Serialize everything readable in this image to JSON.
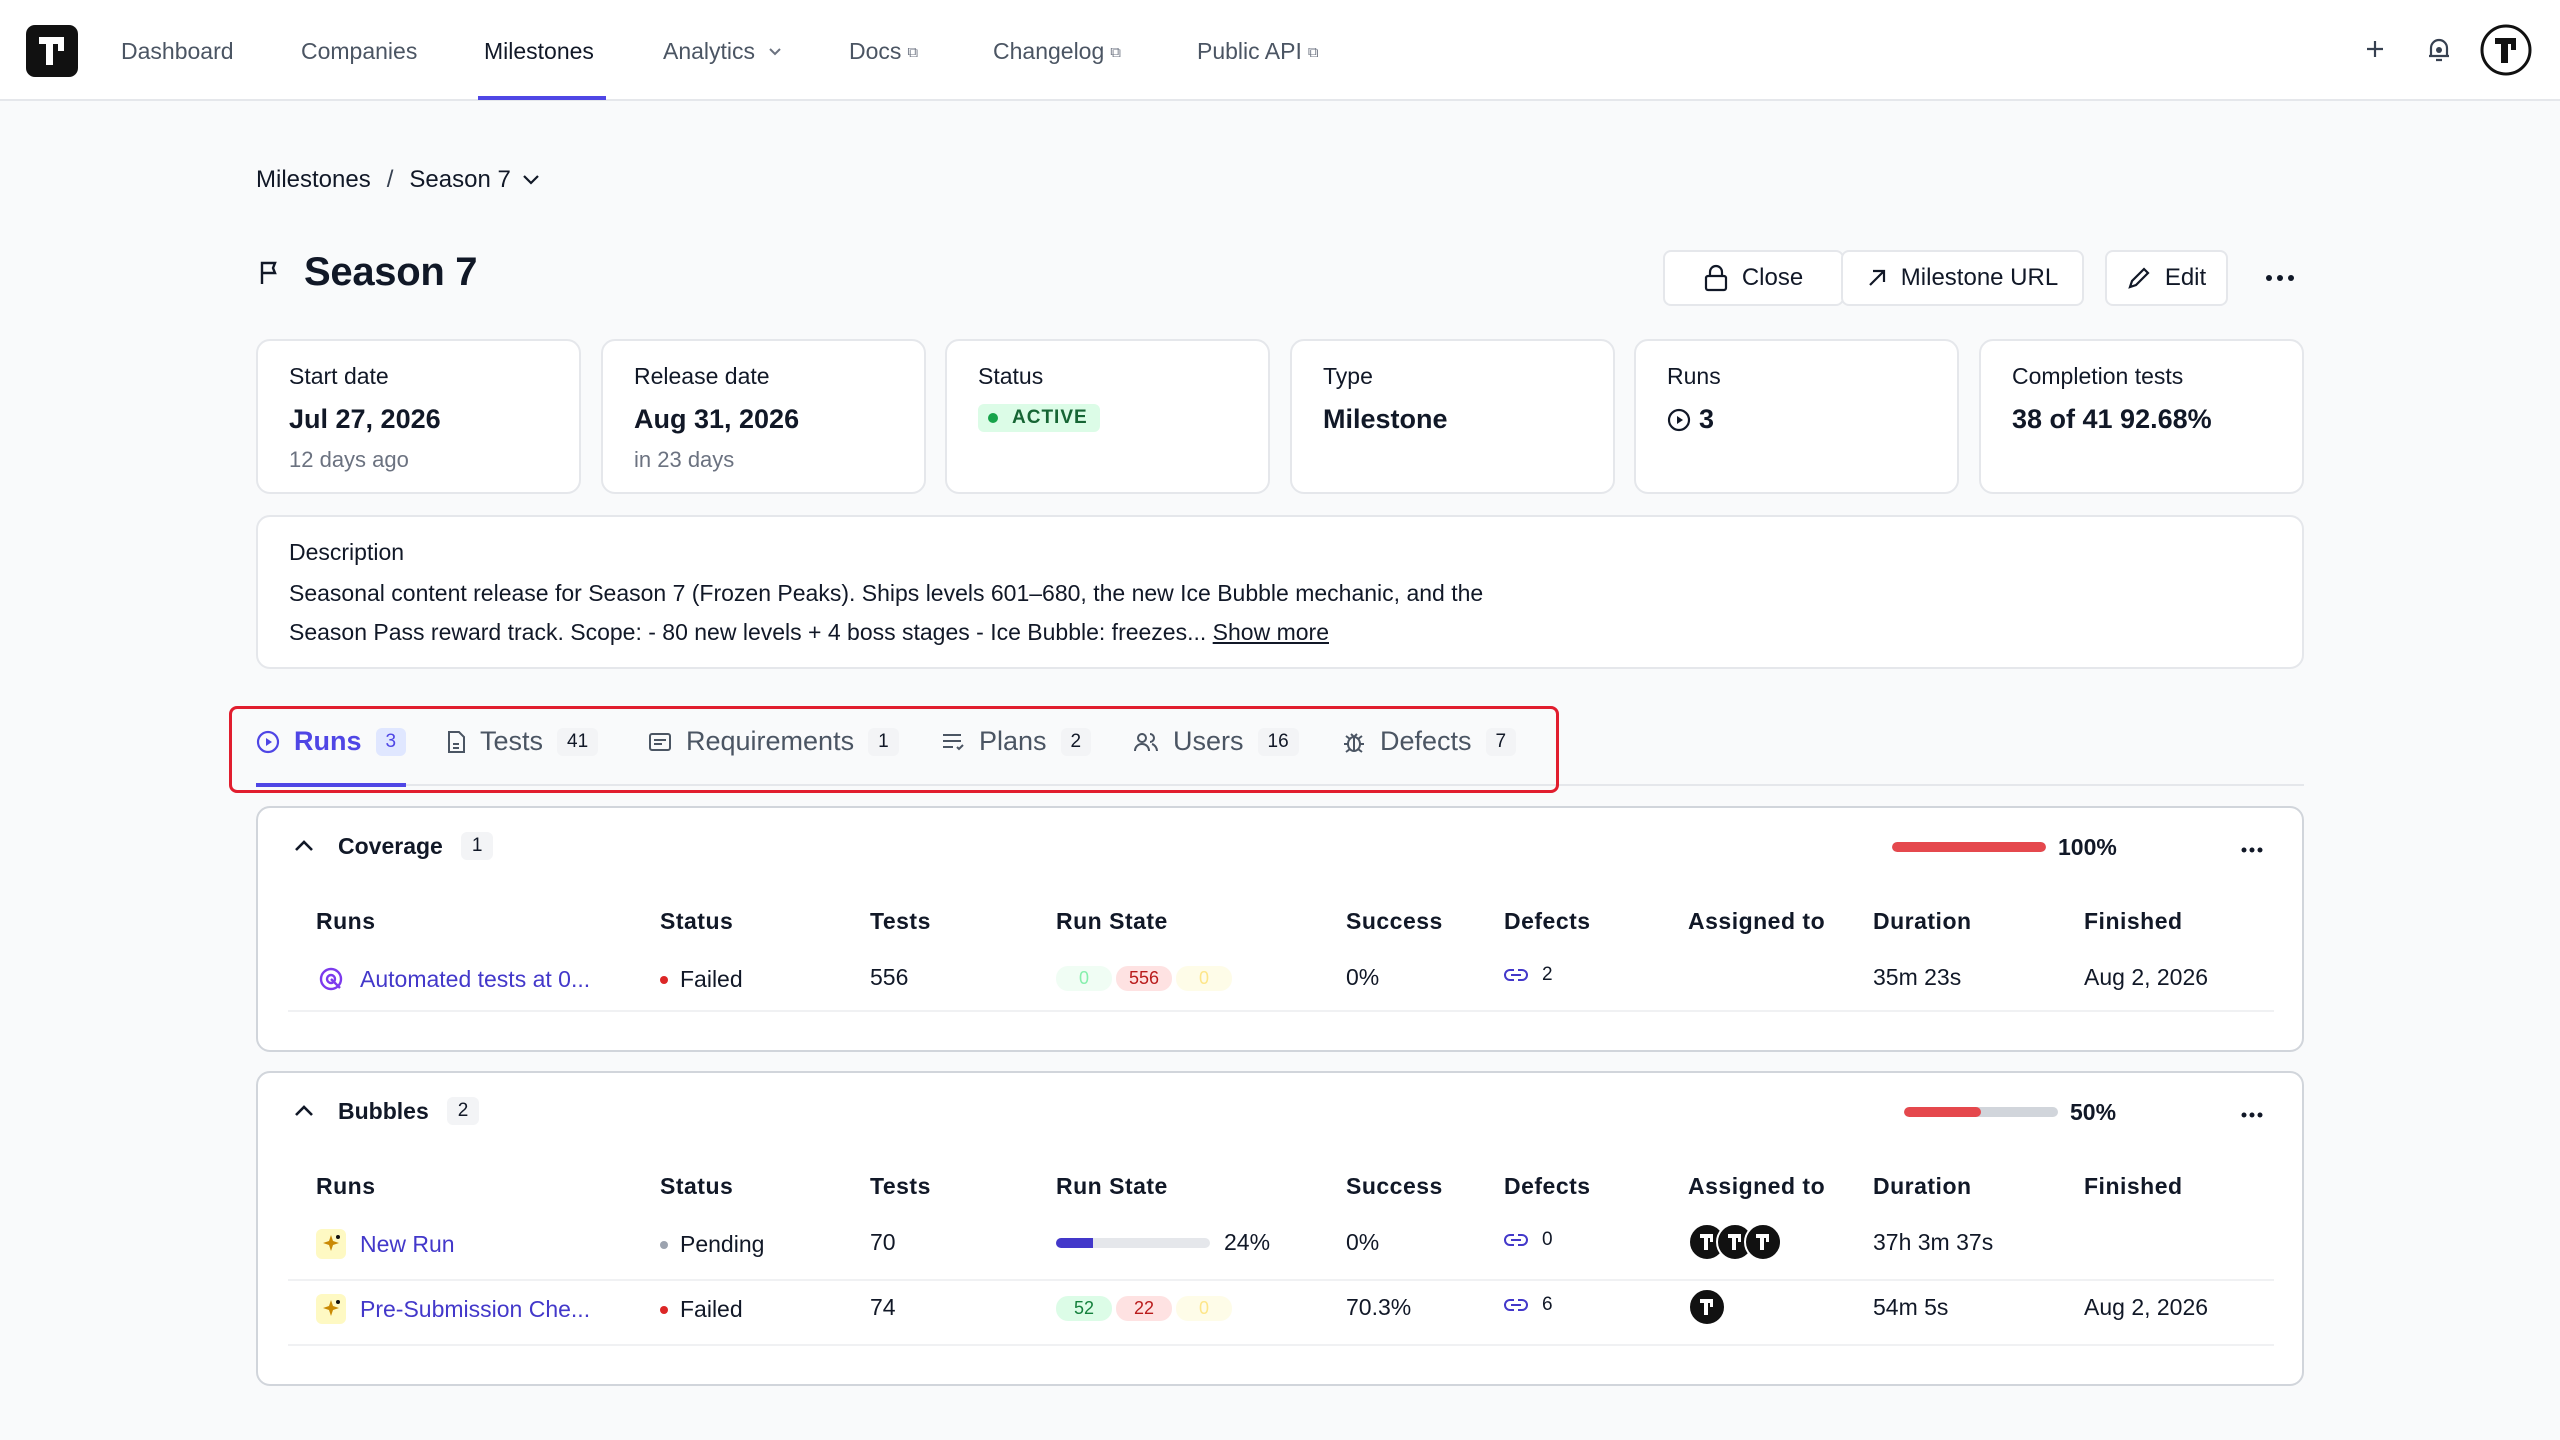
{
  "nav": {
    "items": [
      {
        "label": "Dashboard"
      },
      {
        "label": "Companies"
      },
      {
        "label": "Milestones"
      },
      {
        "label": "Analytics"
      },
      {
        "label": "Docs"
      },
      {
        "label": "Changelog"
      },
      {
        "label": "Public API"
      }
    ],
    "active": "Milestones"
  },
  "breadcrumb": {
    "root": "Milestones",
    "separator": "/",
    "current": "Season 7"
  },
  "header": {
    "title": "Season 7",
    "buttons": {
      "close": "Close",
      "milestone_url": "Milestone URL",
      "edit": "Edit"
    }
  },
  "cards": {
    "start": {
      "label": "Start date",
      "value": "Jul 27, 2026",
      "sub": "12 days ago"
    },
    "release": {
      "label": "Release date",
      "value": "Aug 31, 2026",
      "sub": "in 23 days"
    },
    "status": {
      "label": "Status",
      "value": "ACTIVE"
    },
    "type": {
      "label": "Type",
      "value": "Milestone"
    },
    "runs": {
      "label": "Runs",
      "value": "3"
    },
    "completion": {
      "label": "Completion tests",
      "value": "38 of 41 92.68%"
    }
  },
  "description": {
    "label": "Description",
    "text": "Seasonal content release for Season 7 (Frozen Peaks). Ships levels 601–680, the new Ice Bubble mechanic, and the Season Pass reward track. Scope: - 80 new levels + 4 boss stages - Ice Bubble: freezes...",
    "show_more": "Show more"
  },
  "tabs": [
    {
      "label": "Runs",
      "count": "3"
    },
    {
      "label": "Tests",
      "count": "41"
    },
    {
      "label": "Requirements",
      "count": "1"
    },
    {
      "label": "Plans",
      "count": "2"
    },
    {
      "label": "Users",
      "count": "16"
    },
    {
      "label": "Defects",
      "count": "7"
    }
  ],
  "table_headers": {
    "runs": "Runs",
    "status": "Status",
    "tests": "Tests",
    "run_state": "Run State",
    "success": "Success",
    "defects": "Defects",
    "assigned": "Assigned to",
    "duration": "Duration",
    "finished": "Finished"
  },
  "groups": {
    "coverage": {
      "name": "Coverage",
      "count": "1",
      "progress_pct": "100%",
      "progress": 1.0,
      "rows": [
        {
          "name": "Automated tests at 0...",
          "status": "Failed",
          "tests": "556",
          "state": {
            "passed": "0",
            "failed": "556",
            "skipped": "0"
          },
          "success": "0%",
          "defects": "2",
          "duration": "35m 23s",
          "finished": "Aug 2, 2026"
        }
      ]
    },
    "bubbles": {
      "name": "Bubbles",
      "count": "2",
      "progress_pct": "50%",
      "progress": 0.5,
      "rows": [
        {
          "name": "New Run",
          "status": "Pending",
          "tests": "70",
          "state_progress_pct": "24%",
          "state_progress": 0.24,
          "success": "0%",
          "defects": "0",
          "duration": "37h 3m 37s",
          "finished": ""
        },
        {
          "name": "Pre-Submission Che...",
          "status": "Failed",
          "tests": "74",
          "state": {
            "passed": "52",
            "failed": "22",
            "skipped": "0"
          },
          "success": "70.3%",
          "defects": "6",
          "duration": "54m 5s",
          "finished": "Aug 2, 2026"
        }
      ]
    }
  },
  "colors": {
    "accent": "#4f46e5",
    "failed": "#dc2626",
    "pending": "#9ca3af",
    "progress_red": "#e5484d"
  }
}
